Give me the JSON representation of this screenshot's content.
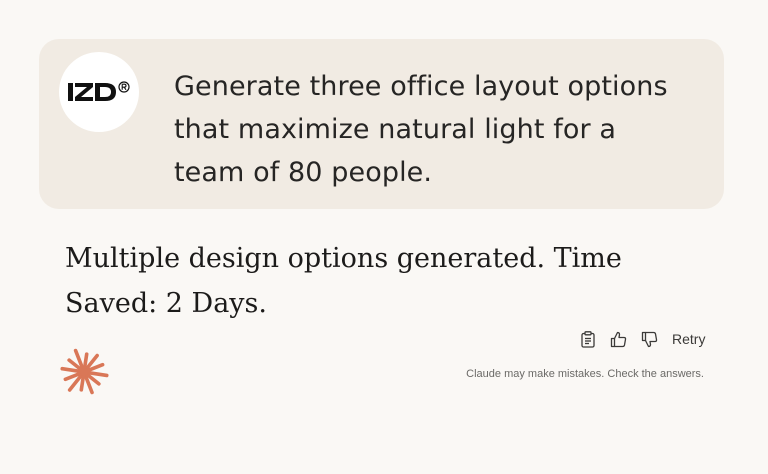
{
  "user_message": {
    "avatar_icon": "lzd-logo-icon",
    "text": "Generate three office layout options that maximize natural light for a team of 80 people."
  },
  "assistant_message": {
    "text": "Multiple design options generated. Time Saved: 2 Days."
  },
  "actions": {
    "copy_icon": "clipboard-icon",
    "thumbs_up_icon": "thumbs-up-icon",
    "thumbs_down_icon": "thumbs-down-icon",
    "retry_label": "Retry"
  },
  "footer": {
    "spark_icon": "claude-spark-icon",
    "disclaimer": "Claude may make mistakes. Check the answers."
  },
  "colors": {
    "page_background": "#faf8f5",
    "user_bubble": "#f1ebe3",
    "spark": "#d97757"
  }
}
